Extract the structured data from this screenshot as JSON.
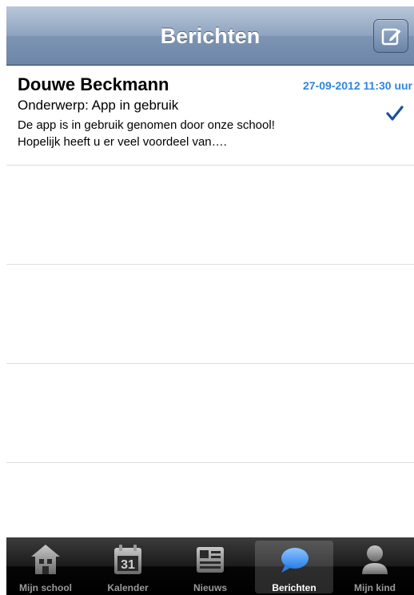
{
  "navbar": {
    "title": "Berichten"
  },
  "messages": [
    {
      "sender": "Douwe Beckmann",
      "date": "27-09-2012 11:30 uur",
      "subject": "Onderwerp: App in gebruik",
      "preview_line1": "De app is in gebruik genomen door onze school!",
      "preview_line2": "Hopelijk heeft u er veel voordeel van…."
    }
  ],
  "tabbar": {
    "tabs": [
      {
        "label": "Mijn school",
        "icon": "school-icon"
      },
      {
        "label": "Kalender",
        "icon": "calendar-icon",
        "calendar_day": "31"
      },
      {
        "label": "Nieuws",
        "icon": "news-icon"
      },
      {
        "label": "Berichten",
        "icon": "chat-bubble-icon",
        "active": true
      },
      {
        "label": "Mijn kind",
        "icon": "person-icon"
      }
    ]
  },
  "colors": {
    "accent_date": "#2f86e0",
    "check": "#1c4f9c",
    "active_tab_icon": "#3d8ff0"
  }
}
